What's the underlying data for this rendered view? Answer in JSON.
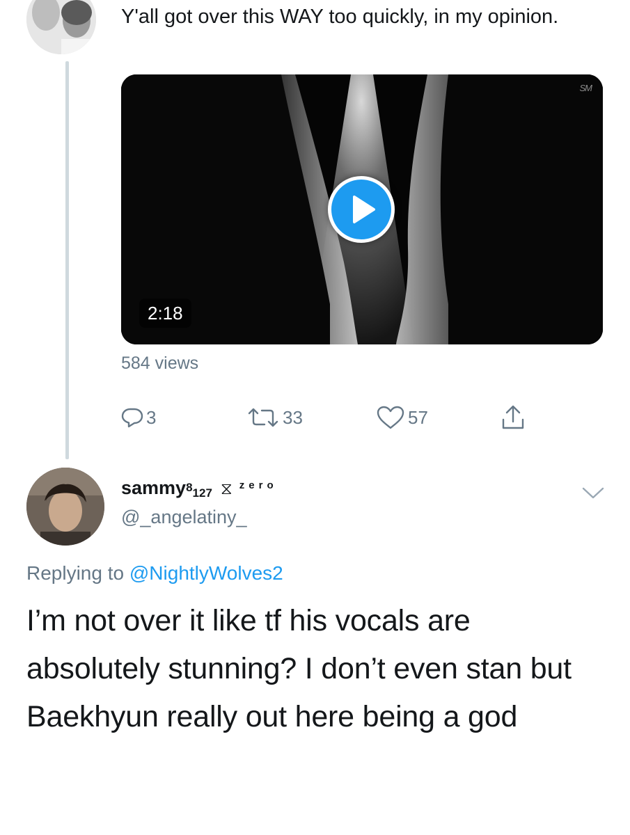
{
  "parent_tweet": {
    "text": "Y'all got over this WAY too quickly, in my opinion.",
    "video": {
      "duration": "2:18",
      "logo": "SM"
    },
    "views": "584 views",
    "actions": {
      "reply_count": "3",
      "retweet_count": "33",
      "like_count": "57"
    }
  },
  "reply_tweet": {
    "display_name": {
      "main": "sammy",
      "superscript": "8",
      "subscript": "127",
      "glyph": "⧖",
      "suffix": "zero"
    },
    "handle": "@_angelatiny_",
    "replying_prefix": "Replying to",
    "replying_mention": "@NightlyWolves2",
    "text": "I’m not over it like tf his vocals are absolutely stunning? I don’t even stan but Baekhyun really out here being a god"
  },
  "icons": {
    "reply": "reply-bubble-icon",
    "retweet": "retweet-icon",
    "like": "heart-icon",
    "share": "share-icon",
    "play": "play-icon",
    "more": "chevron-down-icon"
  },
  "colors": {
    "accent": "#1d9bf0",
    "muted": "#657786",
    "text": "#14171a",
    "thread_line": "#cfd9de"
  }
}
